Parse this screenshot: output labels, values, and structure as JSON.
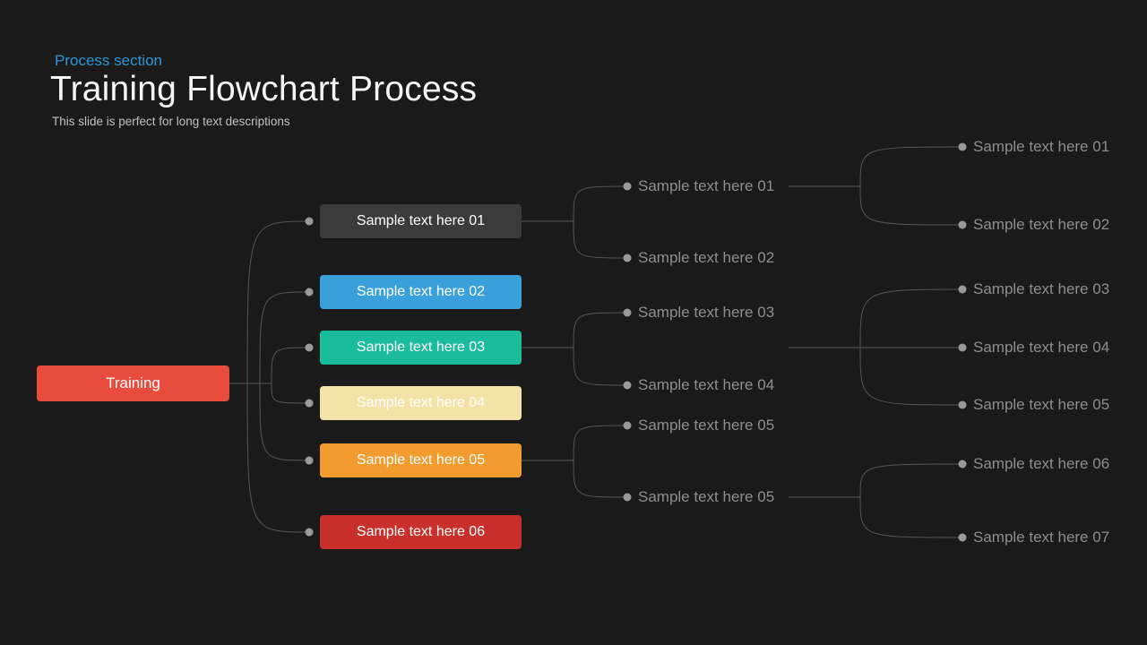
{
  "header": {
    "section": "Process section",
    "title": "Training Flowchart Process",
    "subtitle": "This slide is perfect for long text descriptions"
  },
  "root": {
    "label": "Training"
  },
  "level1": {
    "n1": "Sample text here 01",
    "n2": "Sample text here 02",
    "n3": "Sample text here 03",
    "n4": "Sample text here 04",
    "n5": "Sample text here 05",
    "n6": "Sample text here 06"
  },
  "level2": {
    "a1": "Sample text here 01",
    "a2": "Sample text here 02",
    "b1": "Sample text here 03",
    "b2": "Sample text here 04",
    "c1": "Sample text here 05",
    "c2": "Sample text here 05"
  },
  "level3": {
    "p1": "Sample text here 01",
    "p2": "Sample text here 02",
    "q1": "Sample text here 03",
    "q2": "Sample text here 04",
    "q3": "Sample text here 05",
    "r1": "Sample text here 06",
    "r2": "Sample text here 07"
  },
  "colors": {
    "bg": "#1a1a1a",
    "accent": "#2d97d6",
    "root": "#e74c3c",
    "dark": "#3b3b3b",
    "blue": "#39a0db",
    "teal": "#1abc9c",
    "cream": "#f4e3a7",
    "orange": "#f29b2e",
    "red": "#c9302c"
  }
}
